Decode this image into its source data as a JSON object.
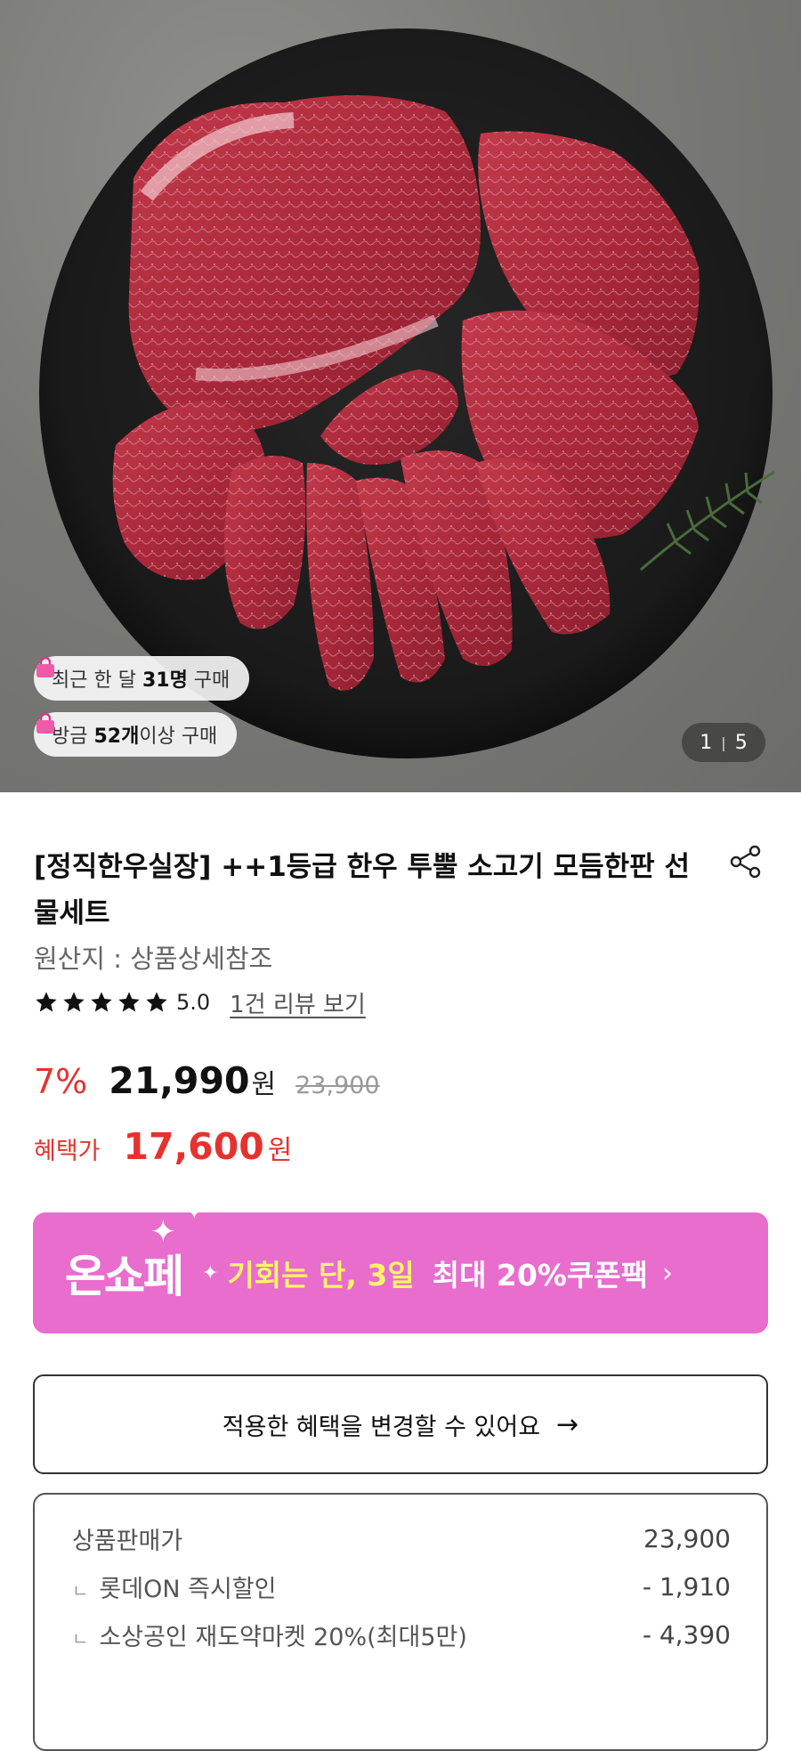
{
  "hero": {
    "badges": [
      {
        "prefix": "최근 한 달 ",
        "strong": "31명",
        "suffix": " 구매"
      },
      {
        "prefix": "방금 ",
        "strong": "52개",
        "suffix": "이상 구매"
      }
    ],
    "pager": {
      "current": "1",
      "separator": "|",
      "total": "5"
    }
  },
  "product": {
    "title": "[정직한우실장] ++1등급 한우 투뿔 소고기 모듬한판 선물세트",
    "origin": "원산지 : 상품상세참조",
    "rating": {
      "stars": 5,
      "score": "5.0",
      "review_link": "1건 리뷰 보기"
    },
    "price": {
      "discount": "7%",
      "sale_price": "21,990",
      "currency": "원",
      "original_price": "23,900"
    },
    "benefit": {
      "label": "혜택가",
      "price": "17,600",
      "currency": "원"
    }
  },
  "promo_banner": {
    "logo": "온쇼페",
    "chance": "기회는 단, 3일",
    "coupon": "최대 20%쿠폰팩",
    "arrow": "›"
  },
  "change_benefit_button": {
    "label": "적용한 혜택을 변경할 수 있어요",
    "arrow": "→"
  },
  "price_breakdown": {
    "rows": [
      {
        "label": "상품판매가",
        "value": "23,900",
        "sub": false
      },
      {
        "label": "롯데ON 즉시할인",
        "value": "- 1,910",
        "sub": true
      },
      {
        "label": "소상공인 재도약마켓 20%(최대5만)",
        "value": "- 4,390",
        "sub": true
      }
    ],
    "sub_marker": "ㄴ"
  },
  "colors": {
    "accent_red": "#e6322e",
    "banner_pink": "#e86dcd",
    "banner_yellow": "#fff36a"
  },
  "icons": [
    "shopping-bag-icon",
    "share-icon",
    "star-icon",
    "chevron-right-icon",
    "arrow-right-icon"
  ]
}
